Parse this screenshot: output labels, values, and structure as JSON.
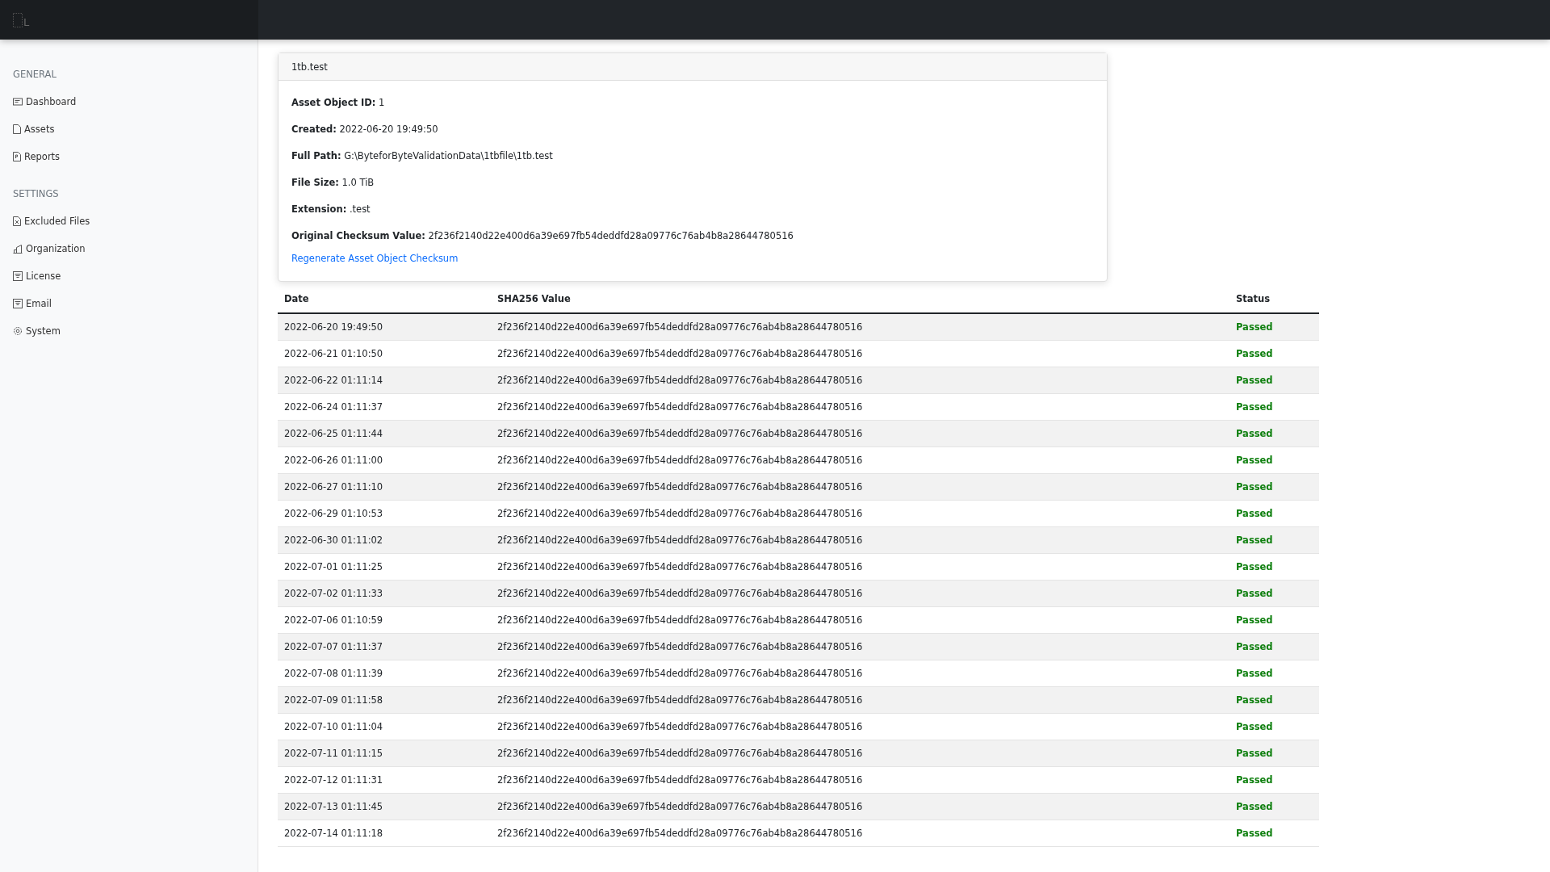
{
  "header": {
    "logo_text": "L"
  },
  "sidebar": {
    "sections": [
      {
        "title": "GENERAL",
        "items": [
          {
            "label": "Dashboard"
          },
          {
            "label": "Assets"
          },
          {
            "label": "Reports"
          }
        ]
      },
      {
        "title": "SETTINGS",
        "items": [
          {
            "label": "Excluded Files"
          },
          {
            "label": "Organization"
          },
          {
            "label": "License"
          },
          {
            "label": "Email"
          },
          {
            "label": "System"
          }
        ]
      }
    ]
  },
  "card": {
    "title": "1tb.test",
    "fields": [
      {
        "label": "Asset Object ID:",
        "value": "1"
      },
      {
        "label": "Created:",
        "value": "2022-06-20 19:49:50"
      },
      {
        "label": "Full Path:",
        "value": "G:\\ByteforByteValidationData\\1tbfile\\1tb.test"
      },
      {
        "label": "File Size:",
        "value": "1.0 TiB"
      },
      {
        "label": "Extension:",
        "value": ".test"
      },
      {
        "label": "Original Checksum Value:",
        "value": "2f236f2140d22e400d6a39e697fb54deddfd28a09776c76ab4b8a28644780516"
      }
    ],
    "link": "Regenerate Asset Object Checksum"
  },
  "table": {
    "columns": [
      "Date",
      "SHA256 Value",
      "Status"
    ],
    "rows": [
      {
        "date": "2022-06-20 19:49:50",
        "sha": "2f236f2140d22e400d6a39e697fb54deddfd28a09776c76ab4b8a28644780516",
        "status": "Passed",
        "kind": "passed"
      },
      {
        "date": "2022-06-21 01:10:50",
        "sha": "2f236f2140d22e400d6a39e697fb54deddfd28a09776c76ab4b8a28644780516",
        "status": "Passed",
        "kind": "passed"
      },
      {
        "date": "2022-06-22 01:11:14",
        "sha": "2f236f2140d22e400d6a39e697fb54deddfd28a09776c76ab4b8a28644780516",
        "status": "Passed",
        "kind": "passed"
      },
      {
        "date": "2022-06-24 01:11:37",
        "sha": "2f236f2140d22e400d6a39e697fb54deddfd28a09776c76ab4b8a28644780516",
        "status": "Passed",
        "kind": "passed"
      },
      {
        "date": "2022-06-25 01:11:44",
        "sha": "2f236f2140d22e400d6a39e697fb54deddfd28a09776c76ab4b8a28644780516",
        "status": "Passed",
        "kind": "passed"
      },
      {
        "date": "2022-06-26 01:11:00",
        "sha": "2f236f2140d22e400d6a39e697fb54deddfd28a09776c76ab4b8a28644780516",
        "status": "Passed",
        "kind": "passed"
      },
      {
        "date": "2022-06-27 01:11:10",
        "sha": "2f236f2140d22e400d6a39e697fb54deddfd28a09776c76ab4b8a28644780516",
        "status": "Passed",
        "kind": "passed"
      },
      {
        "date": "2022-06-29 01:10:53",
        "sha": "2f236f2140d22e400d6a39e697fb54deddfd28a09776c76ab4b8a28644780516",
        "status": "Passed",
        "kind": "passed"
      },
      {
        "date": "2022-06-30 01:11:02",
        "sha": "2f236f2140d22e400d6a39e697fb54deddfd28a09776c76ab4b8a28644780516",
        "status": "Passed",
        "kind": "passed"
      },
      {
        "date": "2022-07-01 01:11:25",
        "sha": "2f236f2140d22e400d6a39e697fb54deddfd28a09776c76ab4b8a28644780516",
        "status": "Passed",
        "kind": "passed"
      },
      {
        "date": "2022-07-02 01:11:33",
        "sha": "2f236f2140d22e400d6a39e697fb54deddfd28a09776c76ab4b8a28644780516",
        "status": "Passed",
        "kind": "passed"
      },
      {
        "date": "2022-07-06 01:10:59",
        "sha": "2f236f2140d22e400d6a39e697fb54deddfd28a09776c76ab4b8a28644780516",
        "status": "Passed",
        "kind": "passed"
      },
      {
        "date": "2022-07-07 01:11:37",
        "sha": "2f236f2140d22e400d6a39e697fb54deddfd28a09776c76ab4b8a28644780516",
        "status": "Passed",
        "kind": "passed"
      },
      {
        "date": "2022-07-08 01:11:39",
        "sha": "2f236f2140d22e400d6a39e697fb54deddfd28a09776c76ab4b8a28644780516",
        "status": "Passed",
        "kind": "passed"
      },
      {
        "date": "2022-07-09 01:11:58",
        "sha": "2f236f2140d22e400d6a39e697fb54deddfd28a09776c76ab4b8a28644780516",
        "status": "Passed",
        "kind": "passed"
      },
      {
        "date": "2022-07-10 01:11:04",
        "sha": "2f236f2140d22e400d6a39e697fb54deddfd28a09776c76ab4b8a28644780516",
        "status": "Passed",
        "kind": "passed"
      },
      {
        "date": "2022-07-11 01:11:15",
        "sha": "2f236f2140d22e400d6a39e697fb54deddfd28a09776c76ab4b8a28644780516",
        "status": "Passed",
        "kind": "passed"
      },
      {
        "date": "2022-07-12 01:11:31",
        "sha": "2f236f2140d22e400d6a39e697fb54deddfd28a09776c76ab4b8a28644780516",
        "status": "Passed",
        "kind": "passed"
      },
      {
        "date": "2022-07-13 01:11:45",
        "sha": "2f236f2140d22e400d6a39e697fb54deddfd28a09776c76ab4b8a28644780516",
        "status": "Passed",
        "kind": "passed"
      },
      {
        "date": "2022-07-14 01:11:18",
        "sha": "2f236f2140d22e400d6a39e697fb54deddfd28a09776c76ab4b8a28644780516",
        "status": "Passed",
        "kind": "passed"
      }
    ]
  }
}
